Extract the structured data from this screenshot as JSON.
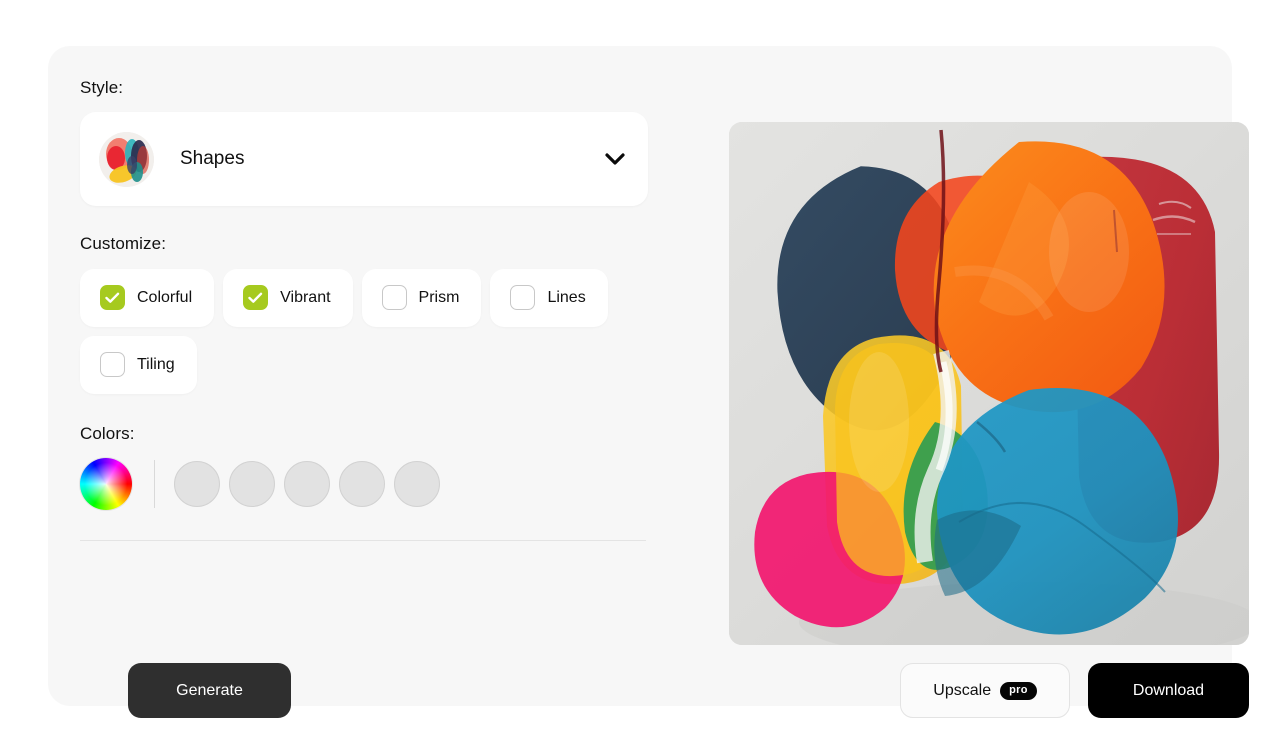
{
  "panel": {
    "background_color": "#f7f7f7"
  },
  "style_section": {
    "label": "Style:",
    "selected": "Shapes",
    "thumbnail_icon": "shapes-thumbnail",
    "chevron_icon": "chevron-down-icon"
  },
  "customize_section": {
    "label": "Customize:",
    "options": [
      {
        "label": "Colorful",
        "checked": true
      },
      {
        "label": "Vibrant",
        "checked": true
      },
      {
        "label": "Prism",
        "checked": false
      },
      {
        "label": "Lines",
        "checked": false
      },
      {
        "label": "Tiling",
        "checked": false
      }
    ],
    "checked_color": "#a6ca1f",
    "check_icon": "checkmark-icon"
  },
  "colors_section": {
    "label": "Colors:",
    "wheel_icon": "color-wheel-icon",
    "swatch_count": 5,
    "swatch_color": "#e2e2e2"
  },
  "actions": {
    "generate_label": "Generate",
    "generate_color": "#2f2f2f",
    "upscale_label": "Upscale",
    "upscale_badge": "pro",
    "download_label": "Download",
    "download_color": "#000000"
  },
  "preview": {
    "alt": "Abstract overlapping translucent blob composition",
    "background_color": "#dcdcdc",
    "palette": {
      "navy": "#2e4257",
      "orange": "#f97316",
      "red_orange": "#f4451c",
      "crimson": "#b81f28",
      "cyan": "#1d92bf",
      "yellow": "#f9c31c",
      "magenta": "#f2166f",
      "green": "#2a9c52"
    }
  }
}
